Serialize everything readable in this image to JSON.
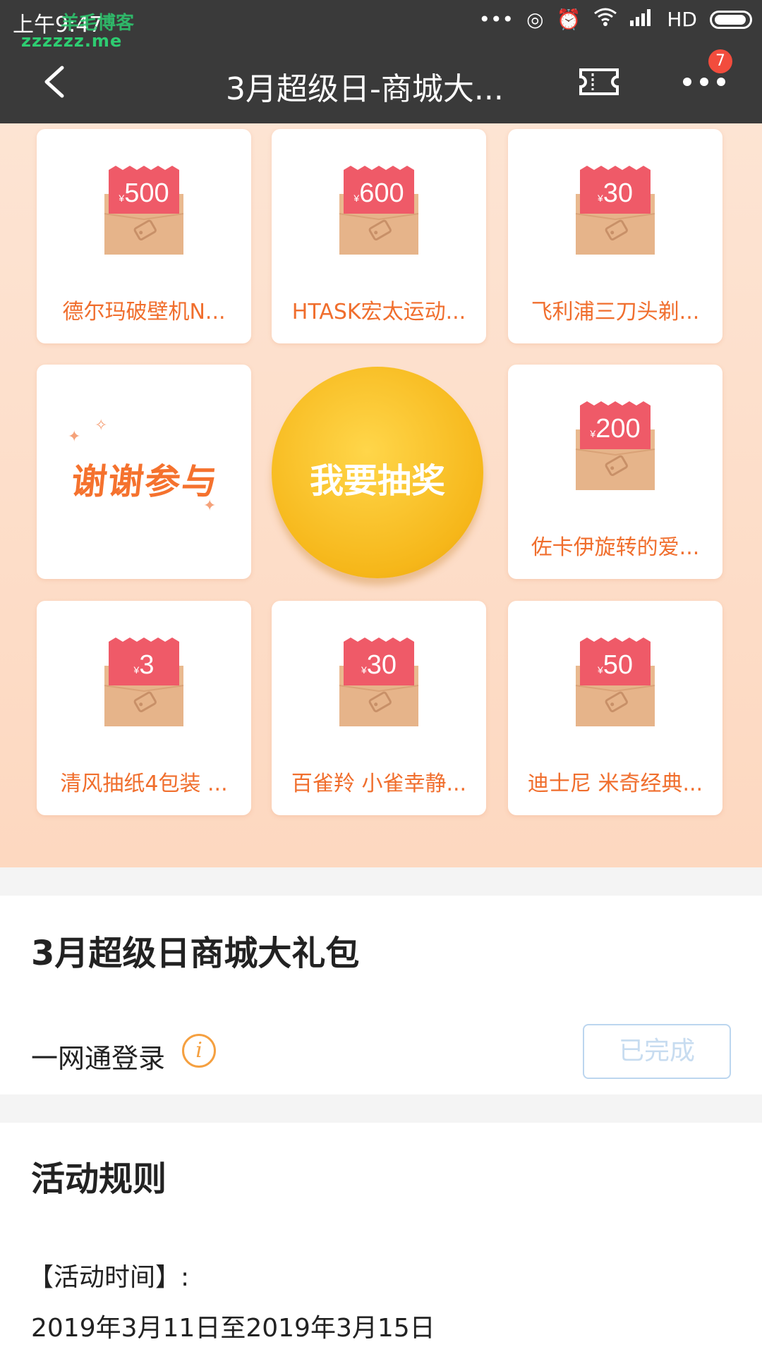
{
  "status_bar": {
    "time": "上午9:47",
    "watermark_top": "羊毛博客",
    "watermark": "zzzzzz.me",
    "network": "HD"
  },
  "app_bar": {
    "title": "3月超级日-商城大...",
    "badge_count": "7"
  },
  "prizes": [
    {
      "amount": "500",
      "currency": "¥",
      "label": "德尔玛破壁机N..."
    },
    {
      "amount": "600",
      "currency": "¥",
      "label": "HTASK宏太运动..."
    },
    {
      "amount": "30",
      "currency": "¥",
      "label": "飞利浦三刀头剃..."
    },
    {
      "amount": "200",
      "currency": "¥",
      "label": "佐卡伊旋转的爱..."
    },
    {
      "amount": "3",
      "currency": "¥",
      "label": "清风抽纸4包装 ..."
    },
    {
      "amount": "30",
      "currency": "¥",
      "label": "百雀羚 小雀幸静..."
    },
    {
      "amount": "50",
      "currency": "¥",
      "label": "迪士尼 米奇经典..."
    }
  ],
  "thanks_text": "谢谢参与",
  "draw_button": "我要抽奖",
  "package": {
    "title": "3月超级日商城大礼包",
    "task_label": "一网通登录",
    "task_status": "已完成"
  },
  "rules": {
    "title": "活动规则",
    "time_label": "【活动时间】:",
    "time_value": "2019年3月11日至2019年3月15日"
  },
  "colors": {
    "topbar": "#3a3a3a",
    "grid_bg": "#fde4d3",
    "prize_text": "#f06e2d",
    "draw_button": "#f6b71a",
    "badge": "#f24c3d",
    "done_border": "#bcd6ef"
  }
}
